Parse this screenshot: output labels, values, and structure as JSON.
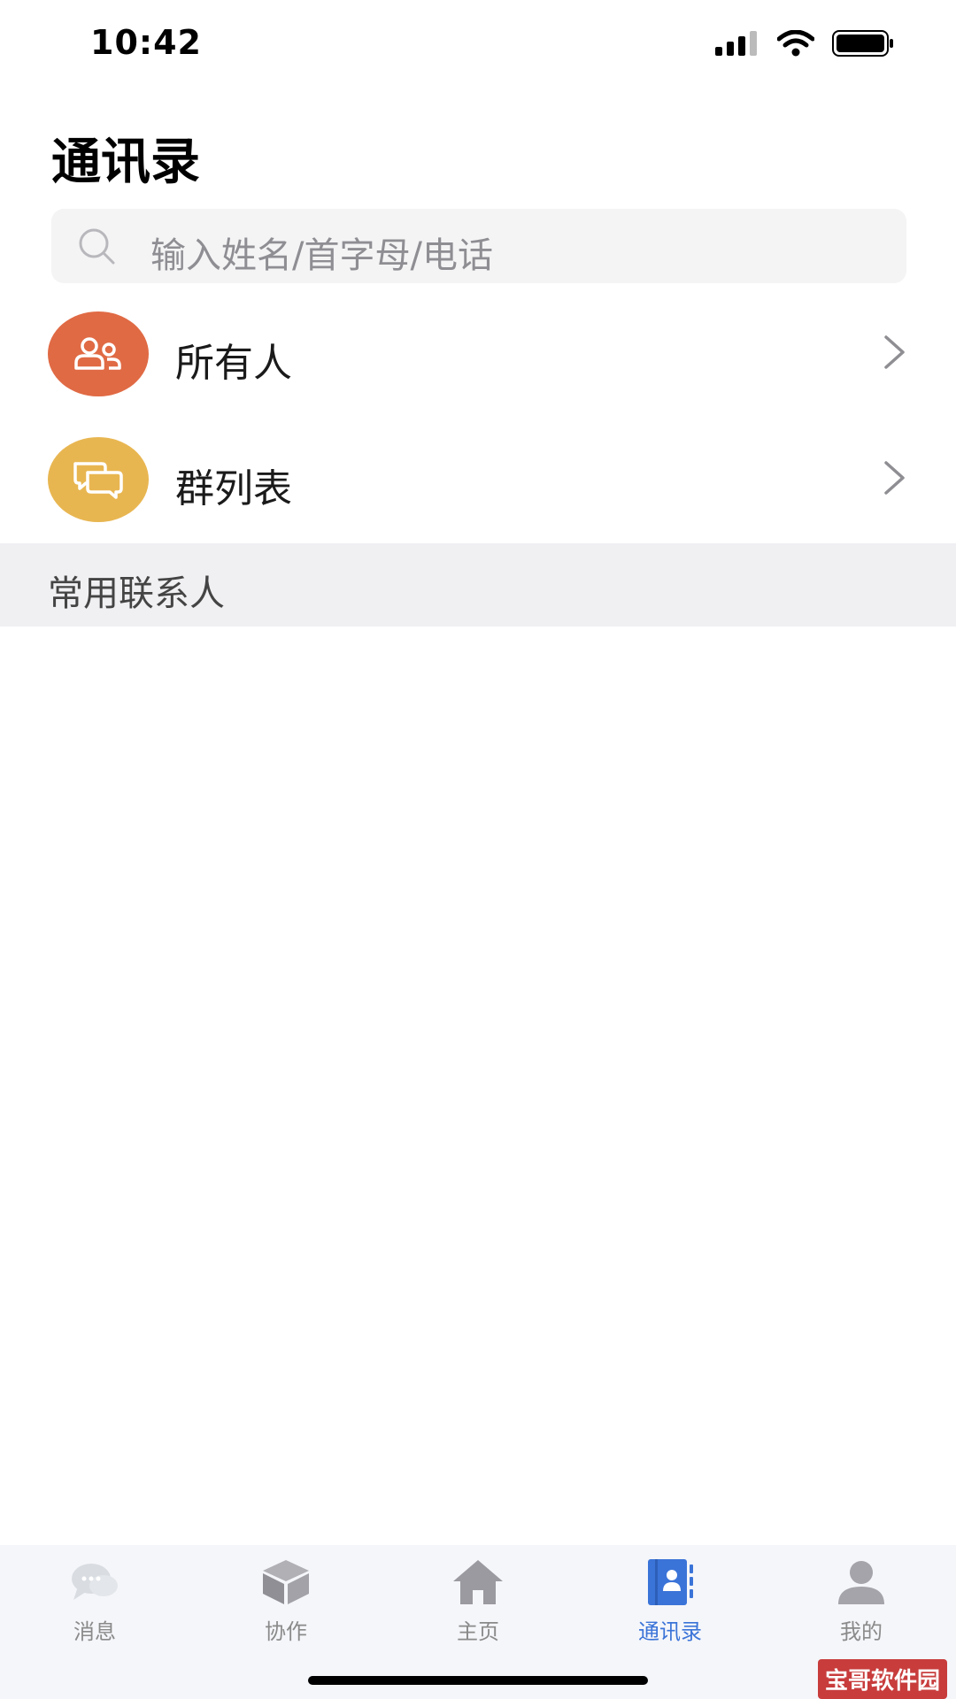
{
  "status_bar": {
    "time": "10:42"
  },
  "header": {
    "title": "通讯录"
  },
  "search": {
    "placeholder": "输入姓名/首字母/电话"
  },
  "list": [
    {
      "label": "所有人",
      "icon": "people-icon",
      "color": "#e06a44"
    },
    {
      "label": "群列表",
      "icon": "chat-bubbles-icon",
      "color": "#e8b651"
    }
  ],
  "section": {
    "title": "常用联系人"
  },
  "tabs": [
    {
      "label": "消息",
      "icon": "message-icon",
      "active": false
    },
    {
      "label": "协作",
      "icon": "cube-icon",
      "active": false
    },
    {
      "label": "主页",
      "icon": "home-icon",
      "active": false
    },
    {
      "label": "通讯录",
      "icon": "contacts-book-icon",
      "active": true
    },
    {
      "label": "我的",
      "icon": "user-icon",
      "active": false
    }
  ],
  "colors": {
    "active_tab": "#3b74d8",
    "inactive_tab": "#8a8a8a"
  },
  "watermark": "宝哥软件园"
}
